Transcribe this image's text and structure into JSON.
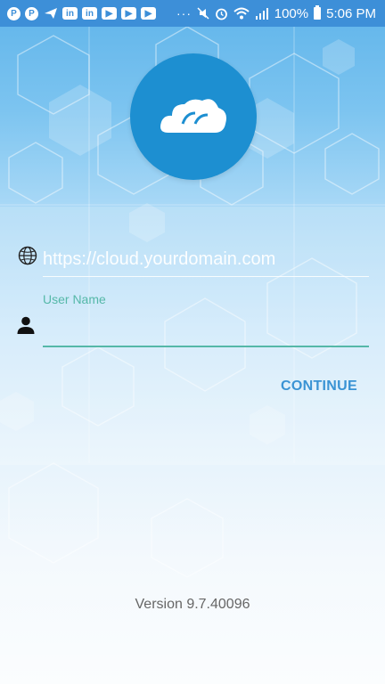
{
  "status_bar": {
    "left_icons": [
      "pinterest-icon",
      "pinterest-icon",
      "send-icon",
      "linkedin-icon",
      "linkedin-icon",
      "youtube-icon",
      "youtube-icon",
      "youtube-icon"
    ],
    "more_indicator": "···",
    "battery_text": "100%",
    "time": "5:06 PM"
  },
  "form": {
    "server_url_placeholder": "https://cloud.yourdomain.com",
    "username_label": "User Name",
    "username_value": "",
    "continue_label": "CONTINUE"
  },
  "footer": {
    "version": "Version 9.7.40096"
  },
  "colors": {
    "status_bar": "#3d8fd8",
    "logo_circle": "#1d8fd1",
    "accent_teal": "#55b8a8",
    "button_blue": "#3a93d4"
  }
}
